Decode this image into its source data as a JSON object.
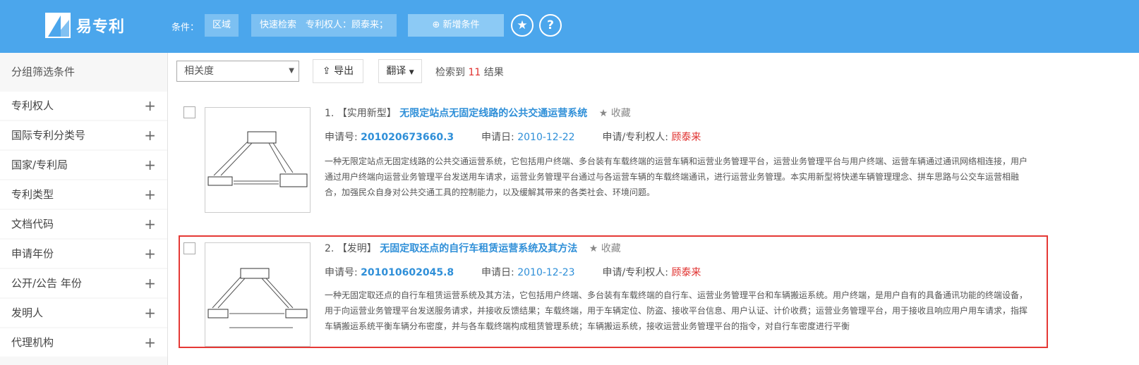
{
  "header": {
    "logo_text": "易专利",
    "condition_label": "条件：",
    "chip_region": "区域",
    "chip_quick": "快速检索　专利权人：顾泰来；",
    "add_condition": "⊕ 新增条件",
    "star_glyph": "★",
    "help_glyph": "?"
  },
  "sidebar": {
    "title": "分组筛选条件",
    "items": [
      {
        "label": "专利权人"
      },
      {
        "label": "国际专利分类号"
      },
      {
        "label": "国家/专利局"
      },
      {
        "label": "专利类型"
      },
      {
        "label": "文档代码"
      },
      {
        "label": "申请年份"
      },
      {
        "label": "公开/公告 年份"
      },
      {
        "label": "发明人"
      },
      {
        "label": "代理机构"
      }
    ],
    "plus_glyph": "+"
  },
  "toolbar": {
    "sort_value": "相关度",
    "export_label": "导出",
    "translate_label": "翻译",
    "count_prefix": "检索到 ",
    "count": "11",
    "count_suffix": " 结果"
  },
  "results": [
    {
      "index": "1.",
      "type": "【实用新型】",
      "title": "无限定站点无固定线路的公共交通运营系统",
      "fav_label": "收藏",
      "appno_label": "申请号: ",
      "appno": "201020673660.3",
      "date_label": "申请日: ",
      "date": "2010-12-22",
      "holder_label": "申请/专利权人: ",
      "holder": "顾泰来",
      "abstract": "一种无限定站点无固定线路的公共交通运营系统，它包括用户终端、多台装有车载终端的运营车辆和运营业务管理平台，运营业务管理平台与用户终端、运营车辆通过通讯网络相连接，用户通过用户终端向运营业务管理平台发送用车请求，运营业务管理平台通过与各运营车辆的车载终端通讯，进行运营业务管理。本实用新型将快递车辆管理理念、拼车思路与公交车运营相融合，加强民众自身对公共交通工具的控制能力，以及缓解其带来的各类社会、环境问题。"
    },
    {
      "index": "2.",
      "type": "【发明】",
      "title": "无固定取还点的自行车租赁运营系统及其方法",
      "fav_label": "收藏",
      "appno_label": "申请号: ",
      "appno": "201010602045.8",
      "date_label": "申请日: ",
      "date": "2010-12-23",
      "holder_label": "申请/专利权人: ",
      "holder": "顾泰来",
      "abstract": "一种无固定取还点的自行车租赁运营系统及其方法，它包括用户终端、多台装有车载终端的自行车、运营业务管理平台和车辆搬运系统。用户终端，是用户自有的具备通讯功能的终端设备，用于向运营业务管理平台发送服务请求，并接收反馈结果；车载终端，用于车辆定位、防盗、接收平台信息、用户认证、计价收费；运营业务管理平台，用于接收且响应用户用车请求，指挥车辆搬运系统平衡车辆分布密度，并与各车载终端构成租赁管理系统；车辆搬运系统，接收运营业务管理平台的指令，对自行车密度进行平衡"
    }
  ]
}
